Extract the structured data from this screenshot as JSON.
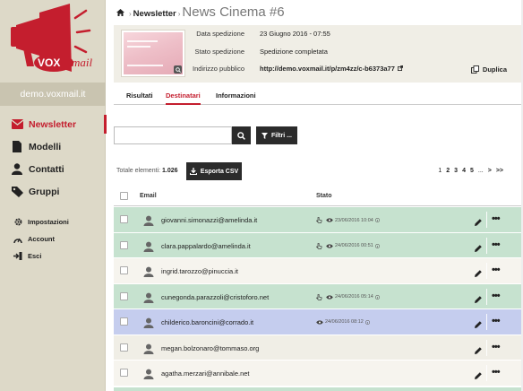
{
  "sidebar": {
    "brand": "voxmail",
    "domain": "demo.voxmail.it",
    "main_items": [
      {
        "label": "Newsletter",
        "icon": "envelope-icon",
        "active": true
      },
      {
        "label": "Modelli",
        "icon": "document-icon",
        "active": false
      },
      {
        "label": "Contatti",
        "icon": "contact-icon",
        "active": false
      },
      {
        "label": "Gruppi",
        "icon": "tag-icon",
        "active": false
      }
    ],
    "sub_items": [
      {
        "label": "Impostazioni",
        "icon": "gear-icon"
      },
      {
        "label": "Account",
        "icon": "gauge-icon"
      },
      {
        "label": "Esci",
        "icon": "logout-icon"
      }
    ]
  },
  "header": {
    "crumb": "Newsletter",
    "title": "News Cinema #6"
  },
  "info": {
    "send_date_label": "Data spedizione",
    "send_date_value": "23 Giugno 2016 - 07:55",
    "status_label": "Stato spedizione",
    "status_value": "Spedizione completata",
    "public_label": "Indirizzo pubblico",
    "public_value": "http://demo.voxmail.it/p/zm4zz/c-b6373a77",
    "duplicate_label": "Duplica"
  },
  "tabs": [
    {
      "label": "Risultati",
      "active": false
    },
    {
      "label": "Destinatari",
      "active": true
    },
    {
      "label": "Informazioni",
      "active": false
    }
  ],
  "toolbar": {
    "search_placeholder": "",
    "filter_label": "Filtri ...",
    "total_label": "Totale elementi:",
    "total_value": "1.026",
    "export_label": "Esporta CSV"
  },
  "pager": {
    "pages": [
      "1",
      "2",
      "3",
      "4",
      "5"
    ],
    "ellipsis": "...",
    "next": ">",
    "last": ">>"
  },
  "table": {
    "col_email": "Email",
    "col_status": "Stato",
    "rows": [
      {
        "email": "giovanni.simonazzi@amelinda.it",
        "status": "23/06/2016 10:04",
        "click": true,
        "open": true,
        "color": "#c6e2cf"
      },
      {
        "email": "clara.pappalardo@amelinda.it",
        "status": "24/06/2016 00:51",
        "click": true,
        "open": true,
        "color": "#c6e2cf"
      },
      {
        "email": "ingrid.tarozzo@pinuccia.it",
        "status": "",
        "click": false,
        "open": false,
        "color": "#f6f4ee"
      },
      {
        "email": "cunegonda.parazzoli@cristoforo.net",
        "status": "24/06/2016 05:14",
        "click": true,
        "open": true,
        "color": "#c6e2cf"
      },
      {
        "email": "childerico.baroncini@corrado.it",
        "status": "24/06/2016 08:12",
        "click": false,
        "open": true,
        "color": "#c5cdee"
      },
      {
        "email": "megan.bolzonaro@tommaso.org",
        "status": "",
        "click": false,
        "open": false,
        "color": "#f0eee6"
      },
      {
        "email": "agatha.merzari@annibale.net",
        "status": "",
        "click": false,
        "open": false,
        "color": "#f6f4ee"
      }
    ]
  },
  "colors": {
    "accent": "#c41e2e",
    "clicked_row": "#c6e2cf",
    "opened_row": "#c5cdee",
    "sidebar_bg": "#ddd9c8"
  }
}
